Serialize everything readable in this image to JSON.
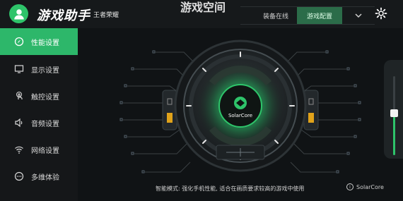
{
  "header": {
    "brand": "游戏助手",
    "game": "王者荣耀",
    "page_title": "游戏空间",
    "tabs": [
      {
        "label": "装备在线",
        "active": false
      },
      {
        "label": "游戏配置",
        "active": true
      }
    ]
  },
  "sidebar": {
    "items": [
      {
        "label": "性能设置",
        "icon": "performance-icon",
        "active": true
      },
      {
        "label": "显示设置",
        "icon": "display-icon",
        "active": false
      },
      {
        "label": "触控设置",
        "icon": "touch-icon",
        "active": false
      },
      {
        "label": "音频设置",
        "icon": "audio-icon",
        "active": false
      },
      {
        "label": "网络设置",
        "icon": "wifi-icon",
        "active": false
      },
      {
        "label": "多维体验",
        "icon": "more-icon",
        "active": false
      }
    ]
  },
  "main": {
    "tip": "智能模式: 强化手机性能, 适合在画质要求较高的游戏中使用",
    "brand_label": "SolarCore",
    "center_label": "SolarCore"
  },
  "colors": {
    "accent": "#2ec46a",
    "sidebar_active": "#2db76a",
    "tab_active": "#2b6c49",
    "background": "#101214"
  },
  "slider": {
    "level": 0.5
  }
}
